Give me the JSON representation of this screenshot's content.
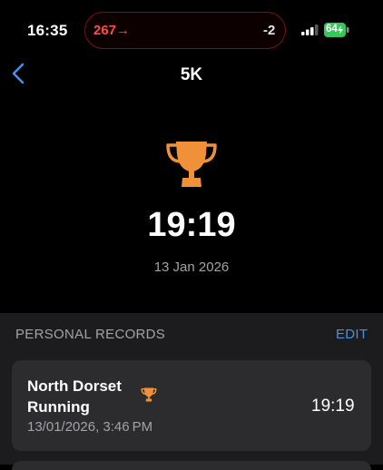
{
  "status_bar": {
    "time": "16:35",
    "live_left": "267→",
    "live_right": "-2",
    "battery": "64"
  },
  "nav": {
    "back_icon": "chevron-left-icon",
    "title": "5K"
  },
  "hero": {
    "icon": "trophy-icon",
    "time": "19:19",
    "date": "13 Jan 2026"
  },
  "section": {
    "header": "PERSONAL RECORDS",
    "edit_label": "EDIT"
  },
  "record": {
    "name": "North Dorset Running",
    "icon": "trophy-icon",
    "datetime": "13/01/2026, 3:46 PM",
    "time": "19:19"
  },
  "colors": {
    "background": "#000000",
    "accent": "#4a90e2",
    "trophy": "#f0913a",
    "island_text": "#ff4b4b",
    "battery": "#34c759"
  }
}
